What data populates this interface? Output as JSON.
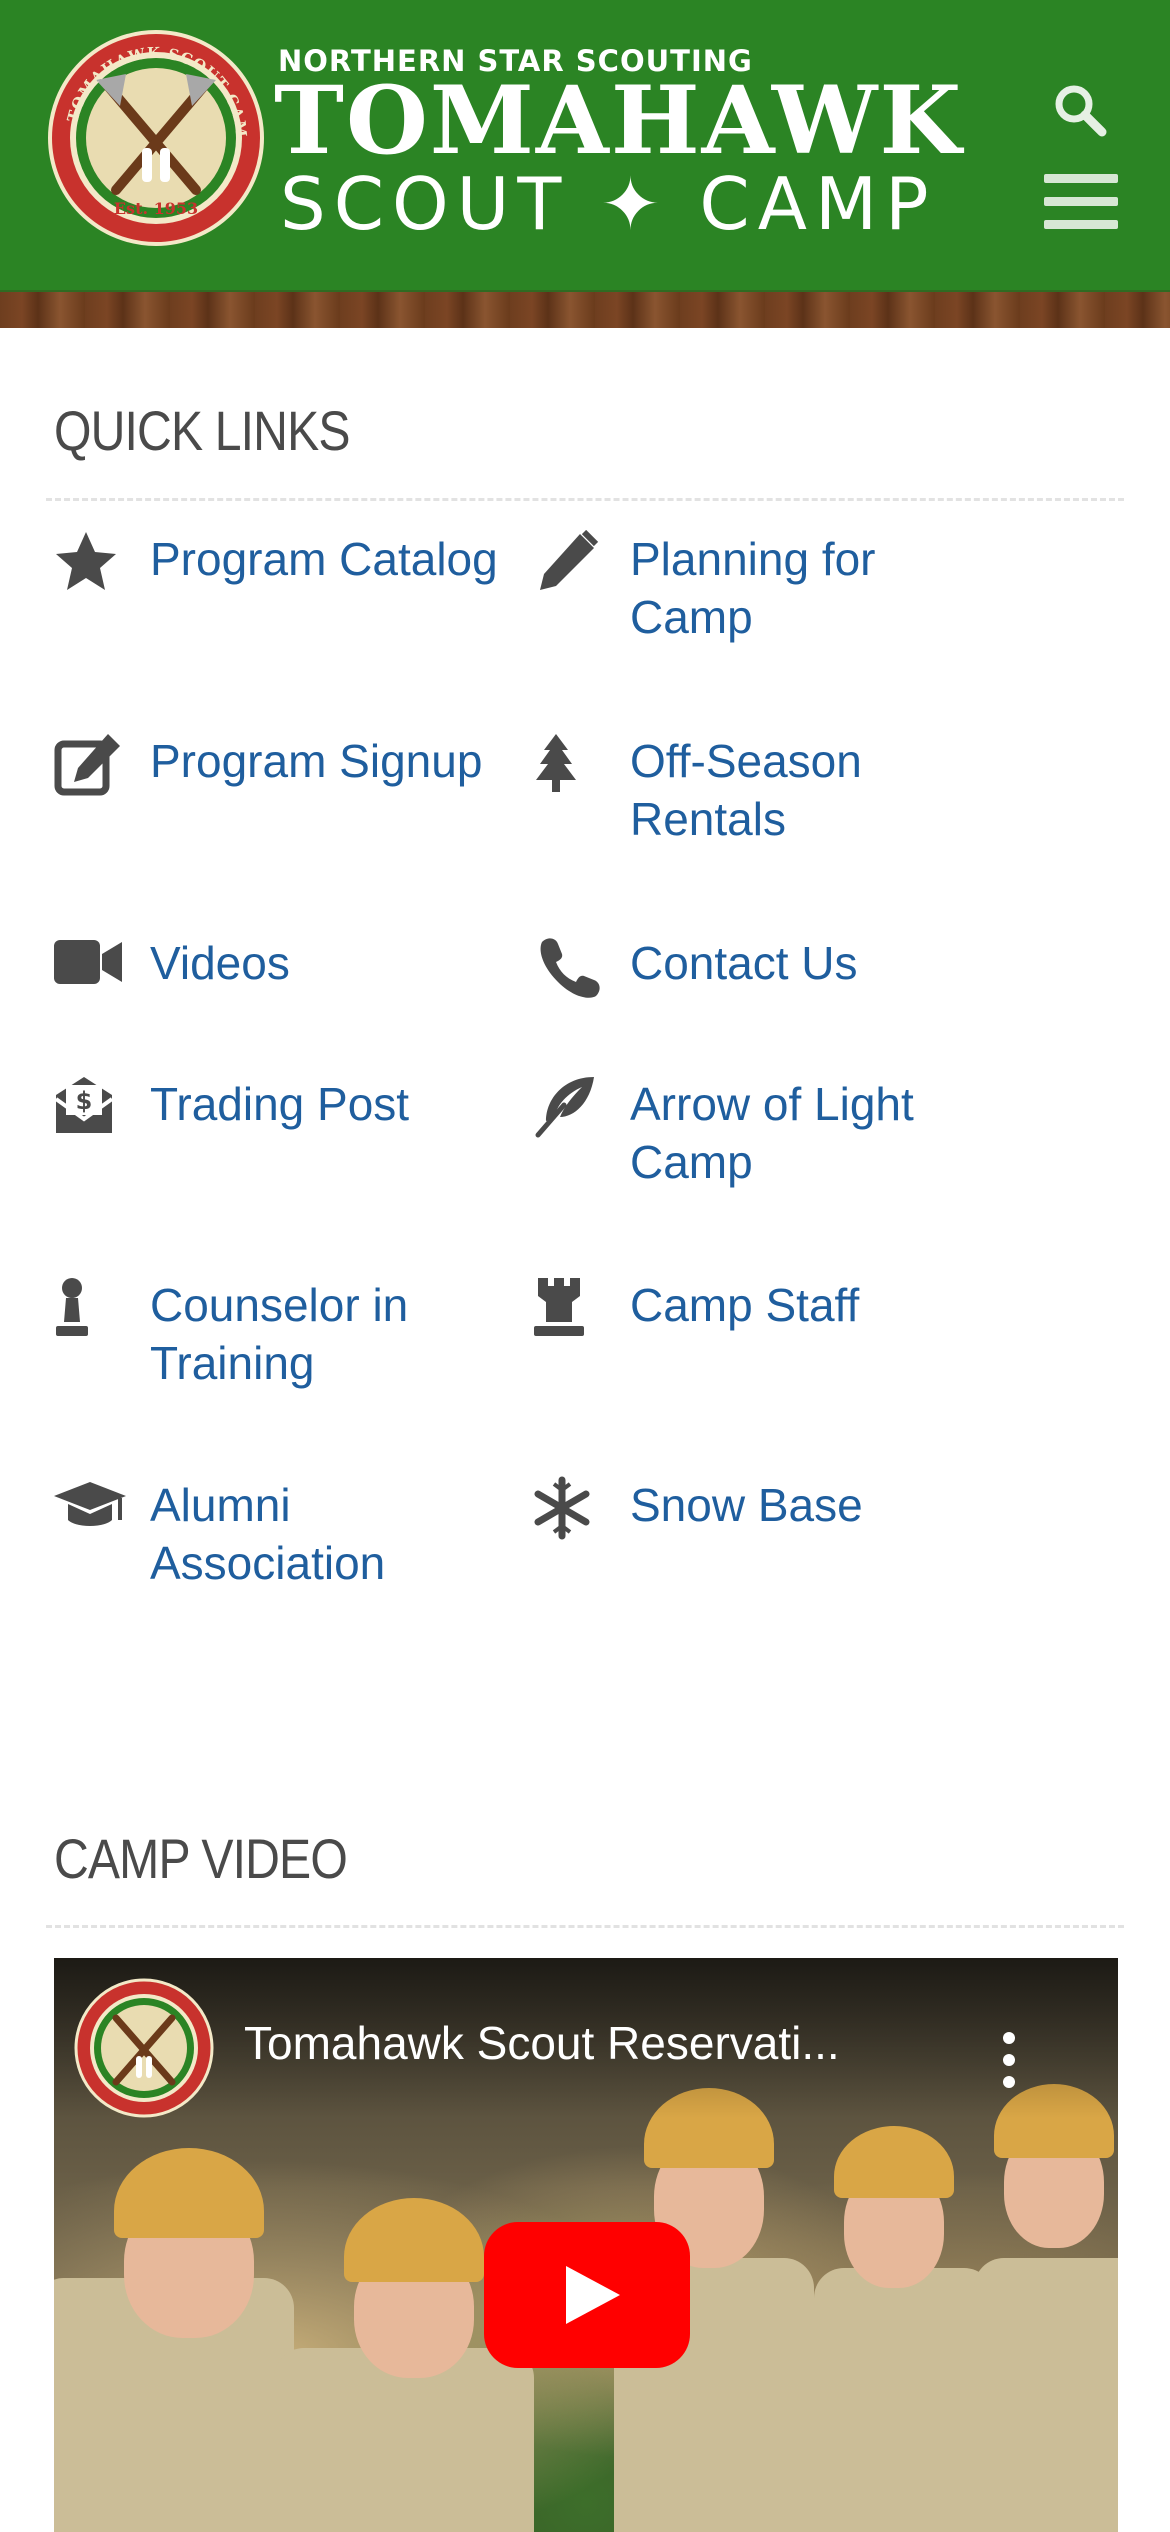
{
  "header": {
    "org_line": "NORTHERN STAR SCOUTING",
    "brand_main": "TOMAHAWK",
    "brand_sub": "SCOUT ✦ CAMP",
    "logo": {
      "ring_text": "TOMAHAWK SCOUT CAMP",
      "est": "Est. 1953"
    },
    "search_icon": "search-icon",
    "menu_icon": "hamburger-icon",
    "colors": {
      "header_bg": "#2b8424",
      "wood": "#6e3e1f",
      "logo_ring": "#c8322d"
    }
  },
  "quick_links": {
    "title": "QUICK LINKS",
    "items": [
      {
        "label": "Program Catalog",
        "icon": "star-icon"
      },
      {
        "label": "Planning for Camp",
        "icon": "pencil-icon"
      },
      {
        "label": "Program Signup",
        "icon": "edit-icon"
      },
      {
        "label": "Off-Season Rentals",
        "icon": "tree-icon"
      },
      {
        "label": "Videos",
        "icon": "video-camera-icon"
      },
      {
        "label": "Contact Us",
        "icon": "phone-icon"
      },
      {
        "label": "Trading Post",
        "icon": "money-envelope-icon"
      },
      {
        "label": "Arrow of Light Camp",
        "icon": "feather-icon"
      },
      {
        "label": "Counselor in Training",
        "icon": "chess-pawn-icon"
      },
      {
        "label": "Camp Staff",
        "icon": "chess-rook-icon"
      },
      {
        "label": "Alumni Association",
        "icon": "graduation-cap-icon"
      },
      {
        "label": "Snow Base",
        "icon": "snowflake-icon"
      }
    ],
    "link_color": "#1f5e9e",
    "icon_color": "#4a4a4a"
  },
  "camp_video": {
    "title": "CAMP VIDEO",
    "video_title": "Tomahawk Scout Reservati...",
    "play_icon": "youtube-play-icon",
    "more_icon": "more-vertical-icon",
    "play_color": "#ff0000"
  }
}
